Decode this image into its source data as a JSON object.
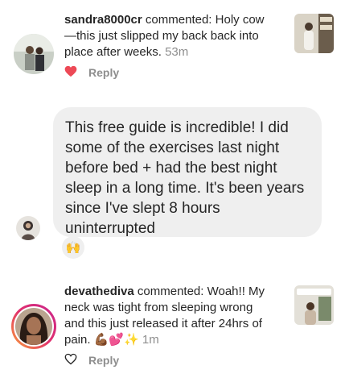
{
  "comments": [
    {
      "username": "sandra8000cr",
      "action": "commented:",
      "text_line1": "Holy cow",
      "text_line2": "—this just slipped my back back into",
      "text_line3": "place after weeks.",
      "time": "53m",
      "reply_label": "Reply",
      "liked": true
    },
    {
      "username": "devathediva",
      "action": "commented:",
      "text_line1": "Woah!! My",
      "text_line2": "neck was tight from sleeping wrong",
      "text_line3": "and this just released it after 24hrs of",
      "text_line4": "pain.",
      "emoji": "💪🏾💕✨",
      "time": "1m",
      "reply_label": "Reply",
      "liked": false
    }
  ],
  "message": {
    "line1": "This free guide is incredible! I did",
    "line2": "some of the exercises last night",
    "line3": "before bed + had the best night",
    "line4": "sleep in a long time. It's been years",
    "line5": "since I've slept 8 hours",
    "line6": "uninterrupted",
    "reaction": "🙌"
  },
  "colors": {
    "heart": "#ed4956",
    "bubble": "#efefef",
    "text": "#262626",
    "meta": "#8e8e8e",
    "story_ring_start": "#f9a13a",
    "story_ring_end": "#c8278f"
  },
  "icons": {
    "like": "heart-icon",
    "unlike": "heart-outline-icon"
  }
}
